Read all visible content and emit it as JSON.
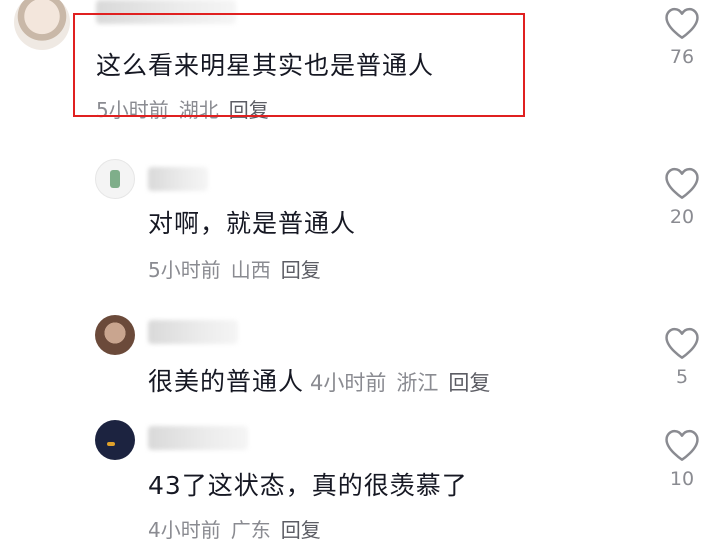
{
  "comments": [
    {
      "text": "这么看来明星其实也是普通人",
      "time": "5小时前",
      "location": "湖北",
      "reply": "回复",
      "likes": "76"
    },
    {
      "text": "对啊，就是普通人",
      "time": "5小时前",
      "location": "山西",
      "reply": "回复",
      "likes": "20"
    },
    {
      "text": "很美的普通人",
      "time": "4小时前",
      "location": "浙江",
      "reply": "回复",
      "likes": "5"
    },
    {
      "text": "43了这状态，真的很羡慕了",
      "time": "4小时前",
      "location": "广东",
      "reply": "回复",
      "likes": "10"
    }
  ],
  "colors": {
    "highlight": "#e02020",
    "meta": "#8a8b91",
    "text": "#161823"
  },
  "icons": {
    "like": "heart-outline-icon"
  }
}
